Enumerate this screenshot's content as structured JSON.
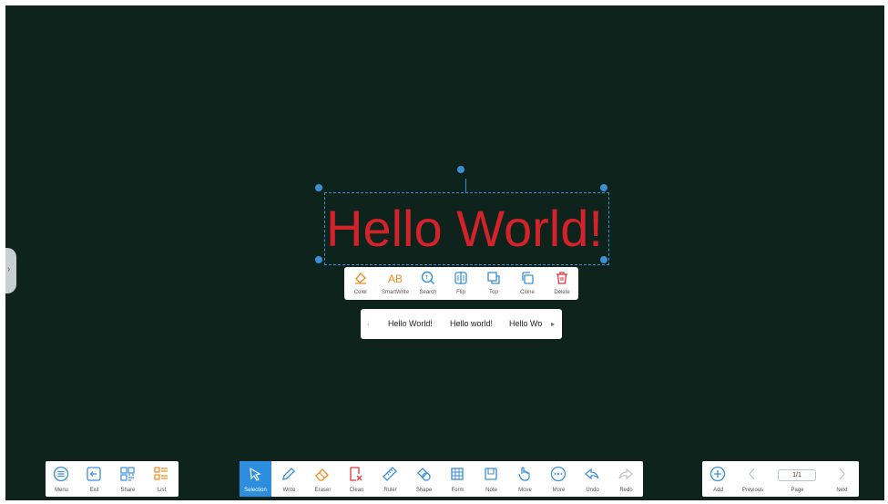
{
  "canvas": {
    "text": "Hello World!",
    "text_color": "#d2232a",
    "background": "#0f231d"
  },
  "context_toolbar": {
    "items": [
      {
        "label": "Color",
        "icon": "paint-bucket-icon"
      },
      {
        "label": "SmartWrite",
        "icon": "smartwrite-icon"
      },
      {
        "label": "Search",
        "icon": "search-icon"
      },
      {
        "label": "Flip",
        "icon": "flip-icon"
      },
      {
        "label": "Top",
        "icon": "bring-to-top-icon"
      },
      {
        "label": "Clone",
        "icon": "clone-icon"
      },
      {
        "label": "Delete",
        "icon": "trash-icon"
      }
    ]
  },
  "suggestions": {
    "items": [
      "Hello World!",
      "Hello world!",
      "Hello Wo"
    ]
  },
  "left_bar": {
    "items": [
      {
        "label": "Menu",
        "icon": "menu-icon"
      },
      {
        "label": "Exit",
        "icon": "exit-icon"
      },
      {
        "label": "Share",
        "icon": "qr-code-icon"
      },
      {
        "label": "List",
        "icon": "list-icon"
      }
    ]
  },
  "tools_bar": {
    "active": "Selection",
    "items": [
      {
        "label": "Selection",
        "icon": "pointer-icon"
      },
      {
        "label": "Write",
        "icon": "pen-icon"
      },
      {
        "label": "Eraser",
        "icon": "eraser-icon"
      },
      {
        "label": "Clean",
        "icon": "clean-icon"
      },
      {
        "label": "Ruler",
        "icon": "ruler-icon"
      },
      {
        "label": "Shape",
        "icon": "shape-icon"
      },
      {
        "label": "Form",
        "icon": "table-icon"
      },
      {
        "label": "Note",
        "icon": "note-icon"
      },
      {
        "label": "Move",
        "icon": "hand-icon"
      },
      {
        "label": "More",
        "icon": "more-icon"
      },
      {
        "label": "Undo",
        "icon": "undo-icon"
      },
      {
        "label": "Redo",
        "icon": "redo-icon"
      }
    ]
  },
  "page_bar": {
    "add_label": "Add",
    "previous_label": "Previous",
    "page_label": "Page",
    "next_label": "Next",
    "page_indicator": "1/1"
  },
  "colors": {
    "accent": "#2d8ee0",
    "orange": "#f08c1e",
    "red": "#e2343b",
    "blue": "#3a8fd9"
  }
}
